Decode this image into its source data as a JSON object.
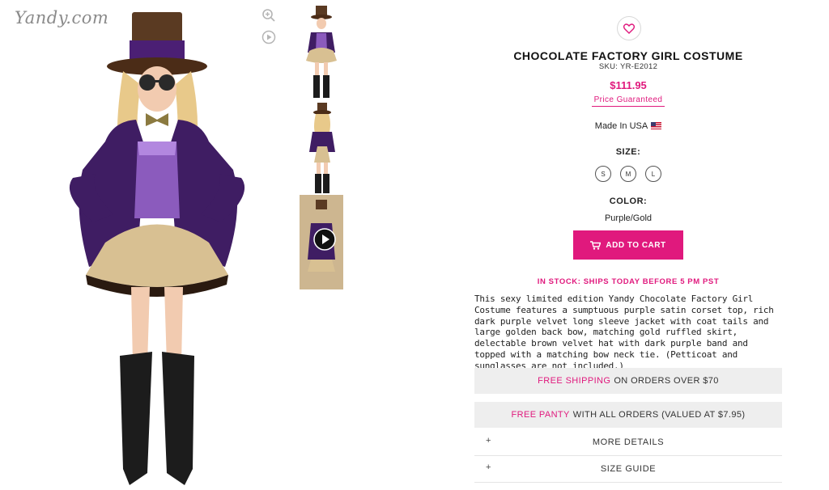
{
  "brand": {
    "logo_text": "Yandy.com",
    "accent_color": "#e0197d"
  },
  "gallery": {
    "zoom_icon": "zoom-in-icon",
    "play_icon": "play-icon",
    "main_image_alt": "costume model front view",
    "thumbnails": [
      "front view",
      "back view",
      "video"
    ]
  },
  "product": {
    "title": "CHOCOLATE FACTORY GIRL COSTUME",
    "sku": "SKU: YR-E2012",
    "price": "$111.95",
    "price_guarantee": "Price Guaranteed",
    "made_in": "Made In USA",
    "size_label": "SIZE:",
    "sizes": [
      "S",
      "M",
      "L"
    ],
    "color_label": "COLOR:",
    "color_value": "Purple/Gold",
    "add_to_cart": "ADD TO CART",
    "stock_status": "IN STOCK: SHIPS TODAY BEFORE 5 PM PST",
    "description": "This sexy limited edition Yandy Chocolate Factory Girl Costume features a sumptuous purple satin corset top, rich dark purple velvet long sleeve jacket with coat tails and large golden back bow, matching gold ruffled skirt, delectable brown velvet hat with dark purple band and topped with a matching bow neck tie. (Petticoat and sunglasses are not included.)"
  },
  "promos": [
    {
      "highlight": "FREE SHIPPING",
      "text": "ON ORDERS OVER $70"
    },
    {
      "highlight": "FREE PANTY",
      "text": "WITH ALL ORDERS (VALUED AT $7.95)"
    }
  ],
  "accordions": [
    {
      "icon": "+",
      "label": "MORE DETAILS"
    },
    {
      "icon": "+",
      "label": "SIZE GUIDE"
    }
  ]
}
